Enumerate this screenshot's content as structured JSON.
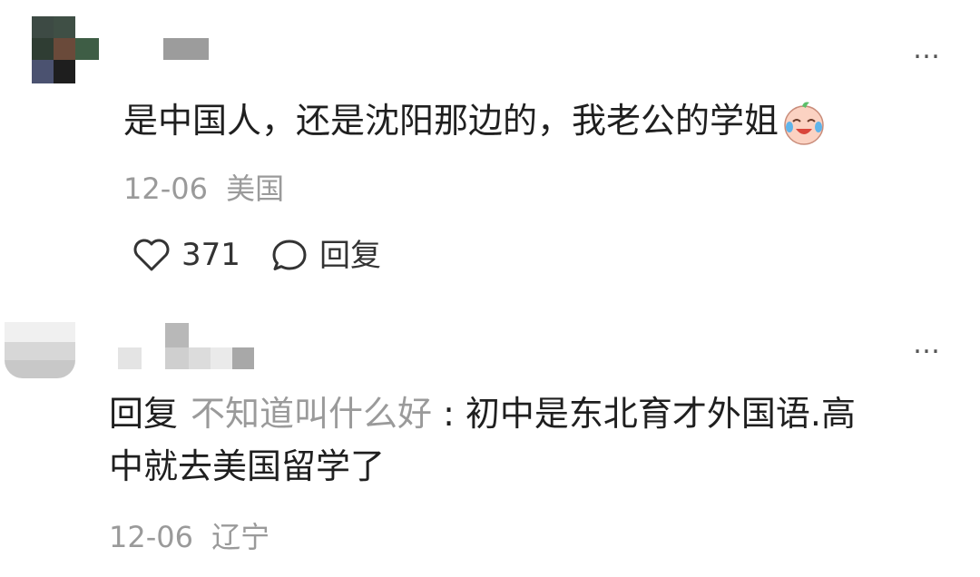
{
  "comments": [
    {
      "avatar_desc": "pixelated avatar",
      "more_label": "…",
      "text": "是中国人，还是沈阳那边的，我老公的学姐",
      "emoji": "laughing-crying-face",
      "date": "12-06",
      "location": "美国",
      "like_count": "371",
      "reply_label": "回复"
    },
    {
      "avatar_desc": "pixelated avatar",
      "more_label": "…",
      "reply_prefix": "回复",
      "reply_to": "不知道叫什么好",
      "separator": " :",
      "text_line1": "初中是东北育才外国语.高",
      "text_line2": "中就去美国留学了",
      "date": "12-06",
      "location": "辽宁"
    }
  ]
}
